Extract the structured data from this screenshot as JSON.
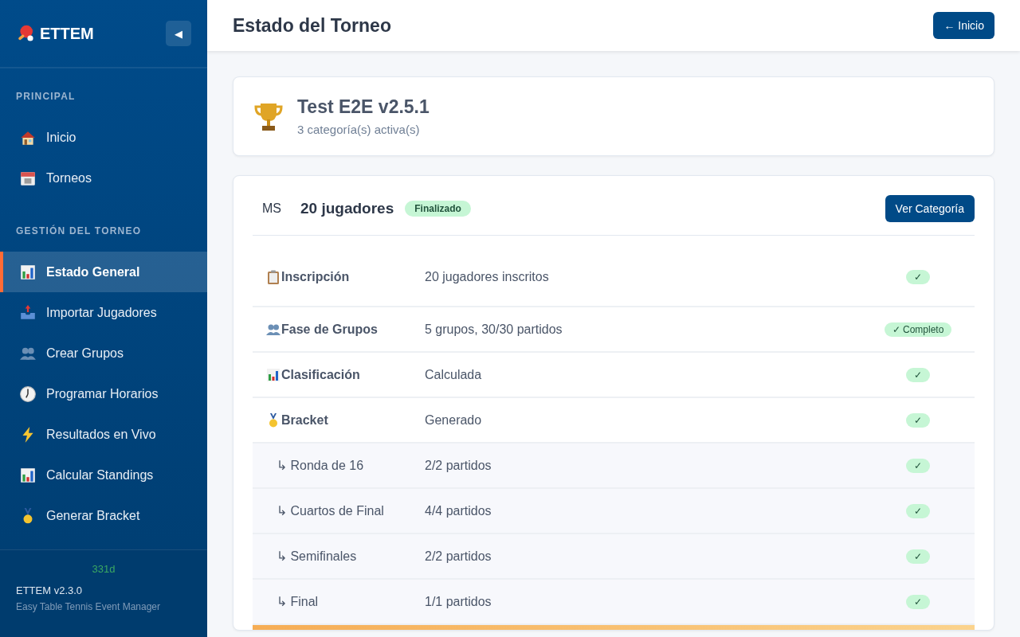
{
  "sidebar": {
    "brand": "ETTEM",
    "collapse_button": "◀",
    "sections": [
      {
        "title": "PRINCIPAL",
        "items": [
          {
            "label": "Inicio",
            "selected": false
          },
          {
            "label": "Torneos",
            "selected": false
          }
        ]
      },
      {
        "title": "GESTIÓN DEL TORNEO",
        "items": [
          {
            "label": "Estado General",
            "selected": true
          },
          {
            "label": "Importar Jugadores",
            "selected": false
          },
          {
            "label": "Crear Grupos",
            "selected": false
          },
          {
            "label": "Programar Horarios",
            "selected": false
          },
          {
            "label": "Resultados en Vivo",
            "selected": false
          },
          {
            "label": "Calcular Standings",
            "selected": false
          },
          {
            "label": "Generar Bracket",
            "selected": false
          }
        ]
      }
    ],
    "footer": {
      "counter": "331d",
      "version": "ETTEM v2.3.0",
      "tagline": "Easy Table Tennis Event Manager"
    }
  },
  "header": {
    "title": "Estado del Torneo",
    "back_button": "← Inicio"
  },
  "tournament": {
    "name": "Test E2E v2.5.1",
    "subtitle": "3 categoría(s) activa(s)"
  },
  "category": {
    "code": "MS",
    "players": "20 jugadores",
    "status": "Finalizado",
    "view_button": "Ver Categoría",
    "steps": [
      {
        "kind": "main",
        "label": "Inscripción",
        "detail": "20 jugadores inscritos",
        "badge": "✓"
      },
      {
        "kind": "main",
        "label": "Fase de Grupos",
        "detail": "5 grupos, 30/30 partidos",
        "badge": "✓ Completo"
      },
      {
        "kind": "main",
        "label": "Clasificación",
        "detail": "Calculada",
        "badge": "✓"
      },
      {
        "kind": "main",
        "label": "Bracket",
        "detail": "Generado",
        "badge": "✓"
      },
      {
        "kind": "sub",
        "label": "↳ Ronda de 16",
        "detail": "2/2 partidos",
        "badge": "✓"
      },
      {
        "kind": "sub",
        "label": "↳ Cuartos de Final",
        "detail": "4/4 partidos",
        "badge": "✓"
      },
      {
        "kind": "sub",
        "label": "↳ Semifinales",
        "detail": "2/2 partidos",
        "badge": "✓"
      },
      {
        "kind": "sub",
        "label": "↳ Final",
        "detail": "1/1 partidos",
        "badge": "✓"
      }
    ]
  }
}
